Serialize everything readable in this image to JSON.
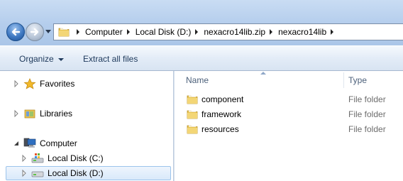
{
  "address": {
    "crumbs": [
      "Computer",
      "Local Disk (D:)",
      "nexacro14lib.zip",
      "nexacro14lib"
    ]
  },
  "toolbar": {
    "organize_label": "Organize",
    "extract_label": "Extract all files"
  },
  "navigation": {
    "items": [
      {
        "label": "Favorites",
        "icon": "star-icon"
      },
      {
        "label": "Libraries",
        "icon": "libraries-icon"
      },
      {
        "label": "Computer",
        "icon": "computer-icon"
      },
      {
        "label": "Local Disk (C:)",
        "icon": "system-drive-icon"
      },
      {
        "label": "Local Disk (D:)",
        "icon": "drive-icon",
        "selected": true
      }
    ]
  },
  "columns": {
    "name": "Name",
    "type": "Type"
  },
  "files": [
    {
      "name": "component",
      "type": "File folder"
    },
    {
      "name": "framework",
      "type": "File folder"
    },
    {
      "name": "resources",
      "type": "File folder"
    }
  ],
  "colors": {
    "folder": "#e8c34f",
    "accent": "#3f79c2"
  }
}
